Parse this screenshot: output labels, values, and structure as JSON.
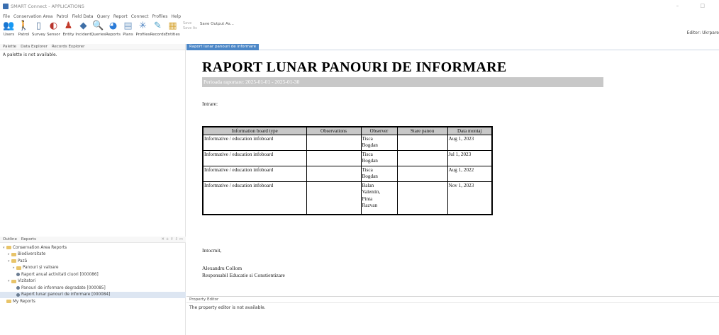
{
  "window": {
    "title": "SMART Connect - APPLICATIONS",
    "controls": "–  □"
  },
  "menu": [
    "File",
    "Conservation Area",
    "Patrol",
    "Field Data",
    "Query",
    "Report",
    "Connect",
    "Profiles",
    "Help"
  ],
  "toolbar": {
    "tools": [
      {
        "label": "Users",
        "icon": "users-icon",
        "glyph": "👥",
        "color": "#2e5c8a"
      },
      {
        "label": "Patrol",
        "icon": "patrol-icon",
        "glyph": "🚶",
        "color": "#c8812c"
      },
      {
        "label": "Survey",
        "icon": "survey-icon",
        "glyph": "▯",
        "color": "#5a7aa0"
      },
      {
        "label": "Sensor",
        "icon": "sensor-icon",
        "glyph": "◐",
        "color": "#b8342c"
      },
      {
        "label": "Entity",
        "icon": "entity-icon",
        "glyph": "♟",
        "color": "#c23b2b"
      },
      {
        "label": "Incident",
        "icon": "incident-icon",
        "glyph": "◆",
        "color": "#3f6fa7"
      },
      {
        "label": "Queries",
        "icon": "queries-icon",
        "glyph": "🔍",
        "color": "#4a7ab0"
      },
      {
        "label": "Reports",
        "icon": "reports-icon",
        "glyph": "◕",
        "color": "#2a7bd8"
      },
      {
        "label": "Plans",
        "icon": "plans-icon",
        "glyph": "▤",
        "color": "#7aa0c8"
      },
      {
        "label": "Profiles",
        "icon": "profiles-icon",
        "glyph": "✳",
        "color": "#4a80c0"
      },
      {
        "label": "Records",
        "icon": "records-icon",
        "glyph": "✎",
        "color": "#4aa0c8"
      },
      {
        "label": "Entities",
        "icon": "entities-icon",
        "glyph": "▦",
        "color": "#d8a83a"
      }
    ],
    "small_buttons": [
      "Save",
      "Save As"
    ],
    "save_output": "Save Output As...",
    "right_label": "Editor: Ukrpare"
  },
  "left_tabs": [
    "Palette",
    "Data Explorer",
    "Records Explorer"
  ],
  "palette_message": "A palette is not available.",
  "outline": {
    "tabs": [
      "Outline",
      "Reports"
    ],
    "tree": [
      {
        "indent": 0,
        "twisty": "▾",
        "kind": "folder",
        "label": "Conservation Area Reports"
      },
      {
        "indent": 1,
        "twisty": "▸",
        "kind": "folder",
        "label": "Biodiversitate"
      },
      {
        "indent": 1,
        "twisty": "▾",
        "kind": "folder",
        "label": "Pază"
      },
      {
        "indent": 2,
        "twisty": "▸",
        "kind": "folder",
        "label": "Panouri și valoare"
      },
      {
        "indent": 2,
        "twisty": "",
        "kind": "report",
        "label": "Raport anual activitati ciuori [000086]"
      },
      {
        "indent": 1,
        "twisty": "▾",
        "kind": "folder",
        "label": "Vizitatori"
      },
      {
        "indent": 2,
        "twisty": "",
        "kind": "report",
        "label": "Panouri de informare degradate [000085]"
      },
      {
        "indent": 2,
        "twisty": "",
        "kind": "report",
        "label": "Raport lunar panouri de informare [000084]",
        "selected": true
      },
      {
        "indent": 0,
        "twisty": "",
        "kind": "folder",
        "label": "My Reports"
      }
    ]
  },
  "editor": {
    "tab_label": "Raport lunar panouri de informare",
    "report_title": "RAPORT LUNAR PANOURI DE INFORMARE",
    "period": "Perioada raportare: 2025-01-01 - 2025-01-30",
    "intro": "Intrare:",
    "table": {
      "headers": [
        "Information board type",
        "Observations",
        "Observer",
        "Stare panou",
        "Data montaj"
      ],
      "rows": [
        [
          "Informative / education infoboard",
          "",
          "Tisca\nBogdan",
          "",
          "Aug 1, 2023"
        ],
        [
          "Informative / education infoboard",
          "",
          "Tisca\nBogdan",
          "",
          "Jul 1, 2023"
        ],
        [
          "Informative / education infoboard",
          "",
          "Tisca\nBogdan",
          "",
          "Aug 1, 2022"
        ],
        [
          "Informative / education infoboard",
          "",
          "Balan\nValentin,\nPinta\nRazvan",
          "",
          "Nov 1, 2023"
        ]
      ]
    },
    "closing": "Intocmit,",
    "signature_name": "Alexandru Collom",
    "signature_role": "Responsabil Educatie si Constientizare"
  },
  "property_editor": {
    "tab": "Property Editor",
    "message": "The property editor is not available."
  }
}
